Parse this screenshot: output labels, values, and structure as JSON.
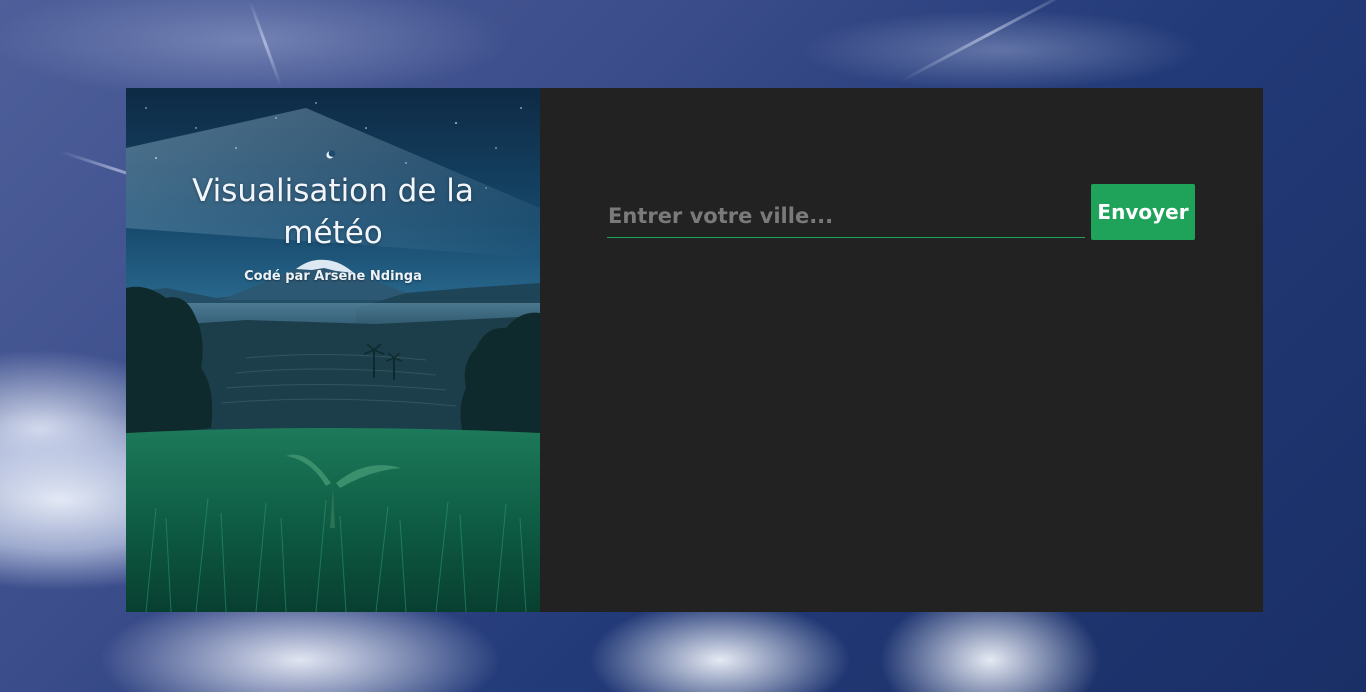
{
  "hero": {
    "title": "Visualisation de la météo",
    "credit": "Codé par Arsene Ndinga"
  },
  "form": {
    "input_placeholder": "Entrer votre ville...",
    "input_value": "",
    "submit_label": "Envoyer"
  },
  "colors": {
    "accent": "#1fa35a",
    "panel_bg": "#222222"
  }
}
